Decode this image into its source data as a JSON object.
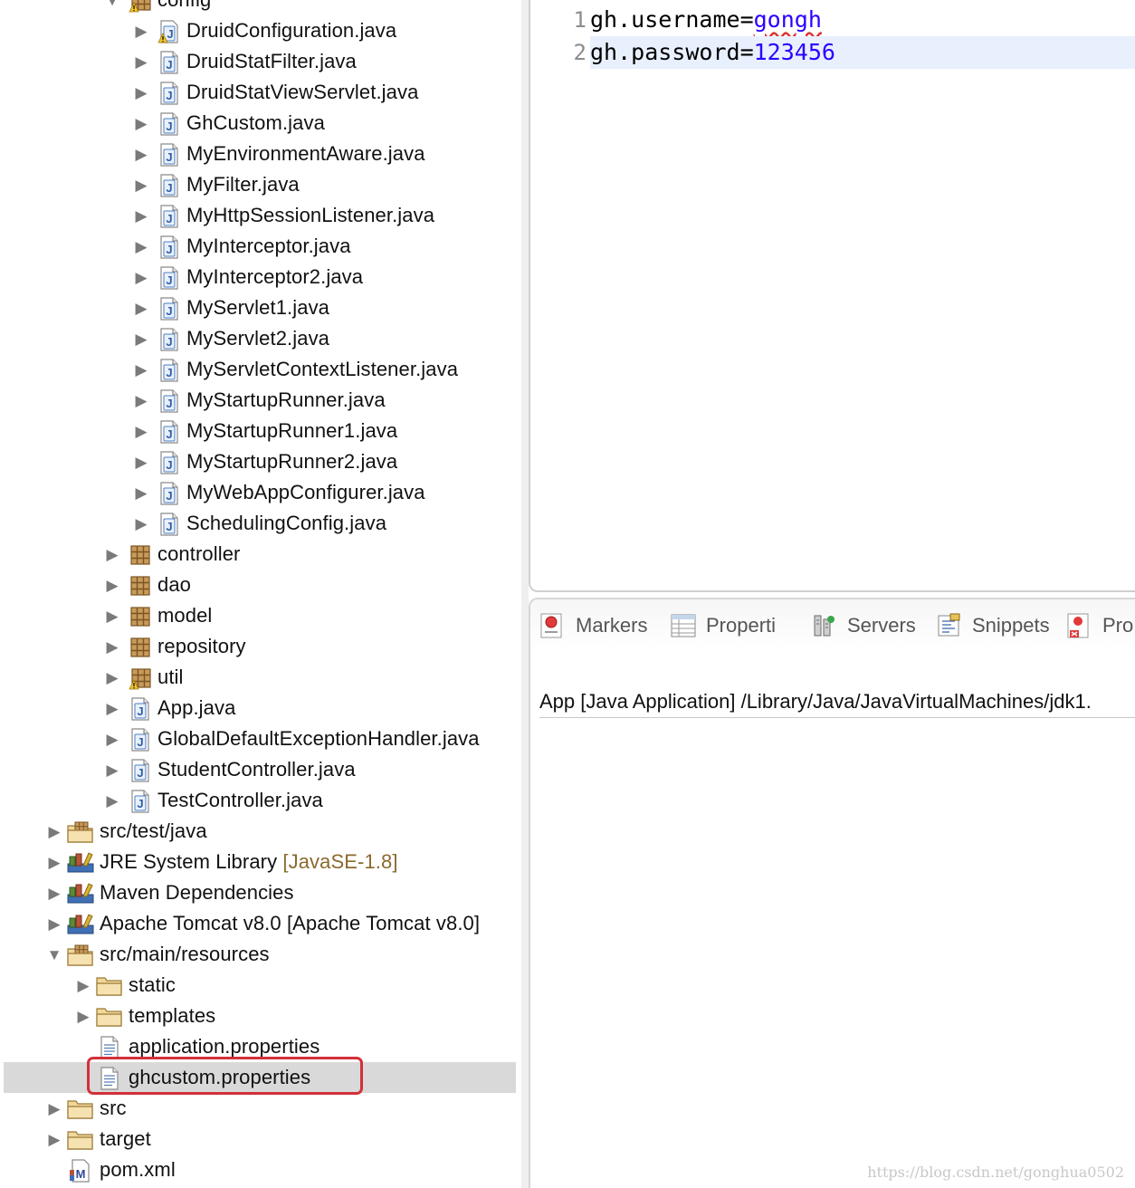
{
  "explorer": {
    "top_partial_label": "config",
    "config_files": [
      {
        "label": "DruidConfiguration.java",
        "warn": true
      },
      {
        "label": "DruidStatFilter.java"
      },
      {
        "label": "DruidStatViewServlet.java"
      },
      {
        "label": "GhCustom.java"
      },
      {
        "label": "MyEnvironmentAware.java"
      },
      {
        "label": "MyFilter.java"
      },
      {
        "label": "MyHttpSessionListener.java"
      },
      {
        "label": "MyInterceptor.java"
      },
      {
        "label": "MyInterceptor2.java"
      },
      {
        "label": "MyServlet1.java"
      },
      {
        "label": "MyServlet2.java"
      },
      {
        "label": "MyServletContextListener.java"
      },
      {
        "label": "MyStartupRunner.java"
      },
      {
        "label": "MyStartupRunner1.java"
      },
      {
        "label": "MyStartupRunner2.java"
      },
      {
        "label": "MyWebAppConfigurer.java"
      },
      {
        "label": "SchedulingConfig.java"
      }
    ],
    "packages": [
      {
        "label": "controller"
      },
      {
        "label": "dao"
      },
      {
        "label": "model"
      },
      {
        "label": "repository"
      },
      {
        "label": "util",
        "warn": true
      }
    ],
    "root_java_files": [
      {
        "label": "App.java"
      },
      {
        "label": "GlobalDefaultExceptionHandler.java"
      },
      {
        "label": "StudentController.java"
      },
      {
        "label": "TestController.java"
      }
    ],
    "src_test_java": "src/test/java",
    "jre_library": {
      "label": "JRE System Library",
      "decoration": "[JavaSE-1.8]"
    },
    "maven_dependencies": "Maven Dependencies",
    "tomcat_library": "Apache Tomcat v8.0 [Apache Tomcat v8.0]",
    "src_main_resources": "src/main/resources",
    "resource_folders": [
      "static",
      "templates"
    ],
    "resource_files": [
      "application.properties",
      "ghcustom.properties"
    ],
    "selected_file": "ghcustom.properties",
    "src_folder": "src",
    "target_folder": "target",
    "pom_file": "pom.xml"
  },
  "editor": {
    "lines": [
      {
        "number": "1",
        "key": "gh.username=",
        "value": "gongh"
      },
      {
        "number": "2",
        "key": "gh.password=",
        "value": "123456"
      }
    ],
    "current_line": 2
  },
  "bottom_panel": {
    "tabs": [
      {
        "label": "Markers",
        "icon": "markers-icon"
      },
      {
        "label": "Properti",
        "icon": "properties-icon"
      },
      {
        "label": "Servers",
        "icon": "servers-icon"
      },
      {
        "label": "Snippets",
        "icon": "snippets-icon"
      },
      {
        "label": "Pro",
        "icon": "progress-icon"
      }
    ],
    "console_text": "App [Java Application] /Library/Java/JavaVirtualMachines/jdk1.",
    "watermark": "https://blog.csdn.net/gonghua0502"
  },
  "colors": {
    "selection_bg": "#d9d9d9",
    "highlight_border": "#d2303a",
    "property_value": "#2a00ff",
    "current_line_bg": "#e8f0fe",
    "library_decoration": "#8a6a2e"
  }
}
